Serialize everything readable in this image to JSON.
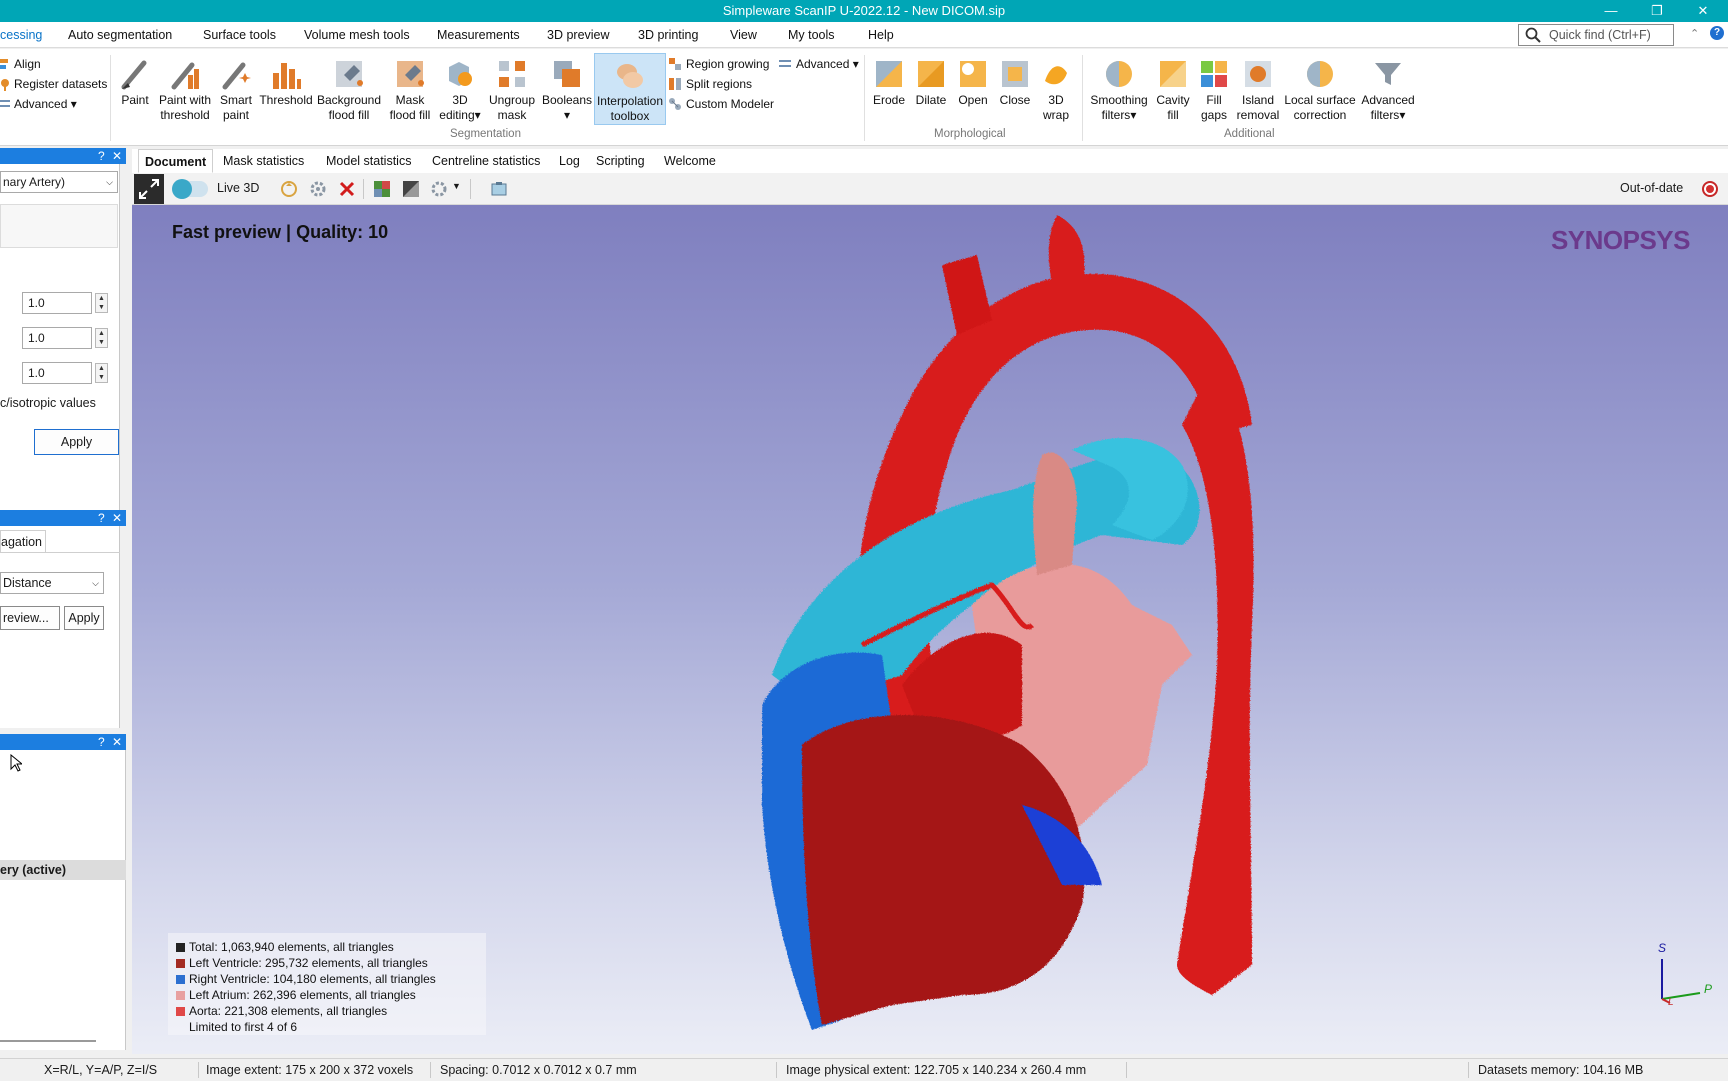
{
  "window": {
    "title": "Simpleware ScanIP U-2022.12 - New DICOM.sip"
  },
  "menu": [
    "cessing",
    "Auto segmentation",
    "Surface tools",
    "Volume mesh tools",
    "Measurements",
    "3D preview",
    "3D printing",
    "View",
    "My tools",
    "Help"
  ],
  "quickfind": {
    "placeholder": "Quick find (Ctrl+F)"
  },
  "ribbon": {
    "left_items": [
      "Align",
      "Register datasets",
      "Advanced"
    ],
    "buttons": [
      {
        "label1": "Paint",
        "label2": ""
      },
      {
        "label1": "Paint with",
        "label2": "threshold"
      },
      {
        "label1": "Smart",
        "label2": "paint"
      },
      {
        "label1": "Threshold",
        "label2": ""
      },
      {
        "label1": "Background",
        "label2": "flood fill"
      },
      {
        "label1": "Mask",
        "label2": "flood fill"
      },
      {
        "label1": "3D",
        "label2": "editing"
      },
      {
        "label1": "Ungroup",
        "label2": "mask"
      },
      {
        "label1": "Booleans",
        "label2": ""
      },
      {
        "label1": "Interpolation",
        "label2": "toolbox"
      }
    ],
    "segmentation_small": [
      "Region growing",
      "Split regions",
      "Custom Modeler"
    ],
    "segmentation_advanced": "Advanced",
    "segmentation_group": "Segmentation",
    "morph_buttons": [
      {
        "label1": "Erode",
        "label2": ""
      },
      {
        "label1": "Dilate",
        "label2": ""
      },
      {
        "label1": "Open",
        "label2": ""
      },
      {
        "label1": "Close",
        "label2": ""
      },
      {
        "label1": "3D",
        "label2": "wrap"
      }
    ],
    "morph_group": "Morphological",
    "additional_buttons": [
      {
        "label1": "Smoothing",
        "label2": "filters"
      },
      {
        "label1": "Cavity",
        "label2": "fill"
      },
      {
        "label1": "Fill",
        "label2": "gaps"
      },
      {
        "label1": "Island",
        "label2": "removal"
      },
      {
        "label1": "Local surface",
        "label2": "correction"
      },
      {
        "label1": "Advanced",
        "label2": "filters"
      }
    ],
    "additional_group": "Additional"
  },
  "left_panel": {
    "dropdown1": "nary Artery)",
    "fields": [
      "1.0",
      "1.0",
      "1.0"
    ],
    "iso_label": "c/isotropic values",
    "apply": "Apply",
    "tab2": "agation",
    "dropdown2": "Distance",
    "preview": "review...",
    "apply2": "Apply",
    "active_item": "ery (active)"
  },
  "doc_tabs": [
    "Document",
    "Mask statistics",
    "Model statistics",
    "Centreline statistics",
    "Log",
    "Scripting",
    "Welcome"
  ],
  "view_toolbar": {
    "live3d": "Live 3D",
    "status": "Out-of-date"
  },
  "view": {
    "preview_text": "Fast preview | Quality: 10",
    "brand": "SYNOPSYS",
    "legend": [
      {
        "text": "Total: 1,063,940 elements, all triangles",
        "color": "#222222"
      },
      {
        "text": "Left Ventricle: 295,732 elements, all triangles",
        "color": "#a32a22"
      },
      {
        "text": "Right Ventricle: 104,180 elements, all triangles",
        "color": "#2c6fd0"
      },
      {
        "text": "Left Atrium: 262,396 elements, all triangles",
        "color": "#e8a0a0"
      },
      {
        "text": "Aorta: 221,308 elements, all triangles",
        "color": "#e04848"
      },
      {
        "text": "Limited to first 4 of 6",
        "color": ""
      }
    ],
    "axes": {
      "s": "S",
      "p": "P",
      "l": "L"
    }
  },
  "statusbar": {
    "coords": "X=R/L, Y=A/P, Z=I/S",
    "extent": "Image extent: 175 x 200 x 372 voxels",
    "spacing": "Spacing: 0.7012 x 0.7012 x 0.7 mm",
    "physical": "Image physical extent: 122.705 x 140.234 x 260.4 mm",
    "memory": "Datasets memory: 104.16 MB"
  },
  "colors": {
    "titlebar": "#00a6b6",
    "panel_header": "#1c7ee0",
    "aorta": "#d91b1b",
    "pulmonary": "#2fb6d6",
    "left_ventricle": "#a51212",
    "right_ventricle": "#1f6bd6",
    "left_atrium": "#e89b9b"
  }
}
